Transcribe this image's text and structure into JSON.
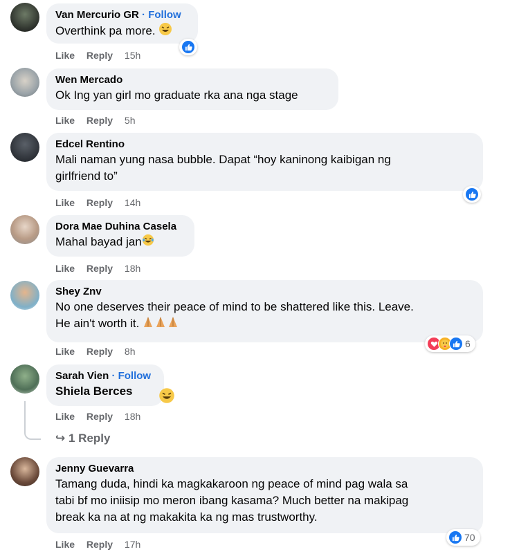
{
  "comments": [
    {
      "author": "Van Mercurio GR",
      "follow": "Follow",
      "text": "Overthink pa more.",
      "emoji": "laugh",
      "like": "Like",
      "reply": "Reply",
      "time": "15h",
      "reactions": [
        "like"
      ],
      "reaction_count": ""
    },
    {
      "author": "Wen Mercado",
      "follow": "",
      "text": "Ok Ing yan girl mo graduate rka ana nga stage",
      "like": "Like",
      "reply": "Reply",
      "time": "5h"
    },
    {
      "author": "Edcel Rentino",
      "follow": "",
      "text_line1": "Mali naman yung nasa bubble. Dapat “hoy kaninong kaibigan ng",
      "text_line2": "girlfriend to”",
      "like": "Like",
      "reply": "Reply",
      "time": "14h",
      "reactions": [
        "like"
      ],
      "reaction_count": ""
    },
    {
      "author": "Dora Mae Duhina Casela",
      "follow": "",
      "text": "Mahal bayad jan",
      "emoji": "laugh-tears",
      "like": "Like",
      "reply": "Reply",
      "time": "18h"
    },
    {
      "author": "Shey Znv",
      "follow": "",
      "text_line1": "No one deserves their peace of mind to be shattered like this. Leave.",
      "text_line2": "He ain't worth it.",
      "emoji": "pray",
      "like": "Like",
      "reply": "Reply",
      "time": "8h",
      "reactions": [
        "love",
        "care",
        "like"
      ],
      "reaction_count": "6"
    },
    {
      "author": "Sarah Vien",
      "follow": "Follow",
      "text": "Shiela Berces",
      "emoji": "laugh",
      "like": "Like",
      "reply": "Reply",
      "time": "18h",
      "replies_label": "1 Reply"
    },
    {
      "author": "Jenny Guevarra",
      "follow": "",
      "text_line1": "Tamang duda, hindi ka magkakaroon ng peace of mind pag wala sa",
      "text_line2": "tabi bf mo iniisip mo meron ibang kasama? Much better na makipag",
      "text_line3": "break ka na at ng makakita ka ng mas trustworthy.",
      "like": "Like",
      "reply": "Reply",
      "time": "17h",
      "reactions": [
        "like"
      ],
      "reaction_count": "70"
    }
  ],
  "colors": {
    "link": "#216fdb",
    "bubble": "#f0f2f5",
    "meta": "#65676b",
    "like": "#1877f2",
    "love": "#f33e58",
    "care": "#f7b125"
  }
}
